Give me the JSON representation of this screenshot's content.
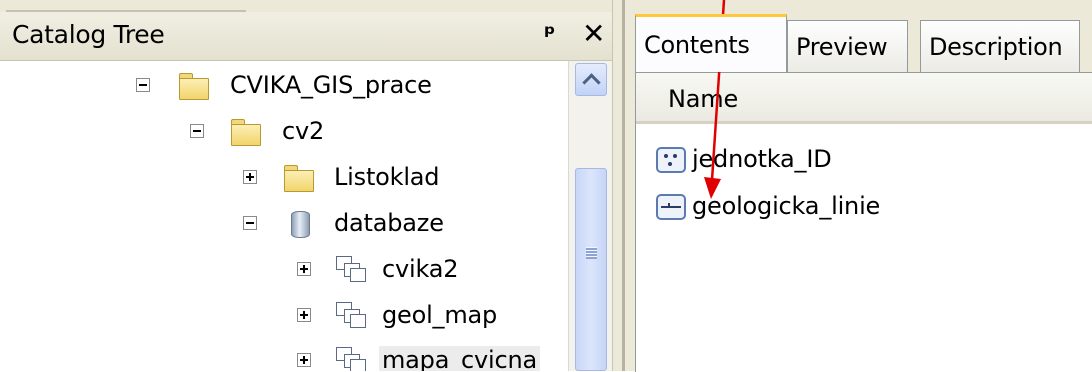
{
  "catalog": {
    "title": "Catalog Tree",
    "tree": [
      {
        "label": "CVIKA_GIS_prace",
        "icon": "folder-icon",
        "expander": "collapse"
      },
      {
        "label": "cv2",
        "icon": "folder-icon",
        "expander": "collapse"
      },
      {
        "label": "Listoklad",
        "icon": "folder-icon",
        "expander": "expand"
      },
      {
        "label": "databaze",
        "icon": "database-icon",
        "expander": "collapse"
      },
      {
        "label": "cvika2",
        "icon": "feature-dataset-icon",
        "expander": "expand"
      },
      {
        "label": "geol_map",
        "icon": "feature-dataset-icon",
        "expander": "expand"
      },
      {
        "label": "mapa_cvicna",
        "icon": "feature-dataset-icon",
        "expander": "expand",
        "selected": true
      }
    ]
  },
  "tabs": [
    {
      "label": "Contents",
      "active": true
    },
    {
      "label": "Preview",
      "active": false
    },
    {
      "label": "Description",
      "active": false
    }
  ],
  "contents": {
    "column_header": "Name",
    "items": [
      {
        "label": "jednotka_ID",
        "icon": "point-feature-class-icon"
      },
      {
        "label": "geologicka_linie",
        "icon": "line-feature-class-icon"
      }
    ]
  },
  "colors": {
    "annotation_arrow": "#e00000",
    "active_tab_accent": "#ffc83c"
  }
}
